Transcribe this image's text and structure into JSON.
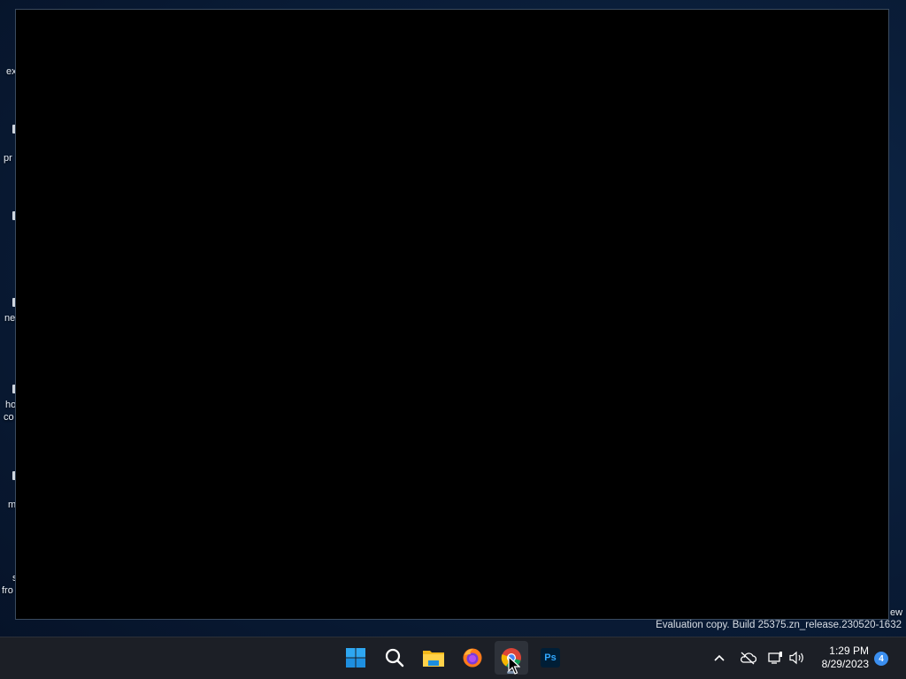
{
  "desktop": {
    "labels": [
      "ex",
      "pr",
      "ne",
      "ho",
      "co",
      "m",
      "s",
      "fro",
      "ew"
    ]
  },
  "window": {
    "content": ""
  },
  "watermark": {
    "text": "Evaluation copy. Build 25375.zn_release.230520-1632"
  },
  "taskbar": {
    "apps": [
      {
        "name": "Start",
        "icon": "windows-icon"
      },
      {
        "name": "Search",
        "icon": "search-icon"
      },
      {
        "name": "File Explorer",
        "icon": "folder-icon"
      },
      {
        "name": "Firefox",
        "icon": "firefox-icon"
      },
      {
        "name": "Chrome",
        "icon": "chrome-icon",
        "active": true
      },
      {
        "name": "Photoshop",
        "icon": "photoshop-icon",
        "text": "Ps"
      }
    ],
    "tray": {
      "time": "1:29 PM",
      "date": "8/29/2023",
      "notification_count": "4"
    }
  },
  "colors": {
    "accent": "#3b8ff0",
    "taskbar": "#1c1f26",
    "photoshop": "#31a8ff"
  }
}
